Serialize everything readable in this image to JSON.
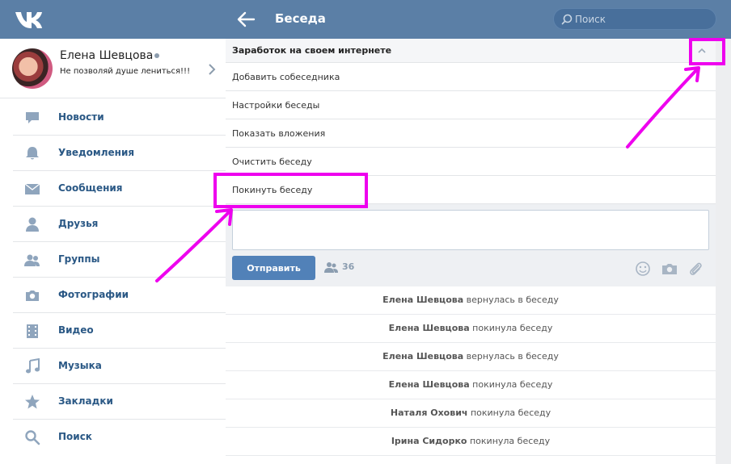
{
  "header": {
    "logo_text": "VK",
    "title": "Беседа",
    "search_placeholder": "Поиск"
  },
  "profile": {
    "name": "Елена Шевцова",
    "status": "Не позволяй душе лениться!!!"
  },
  "sidebar": {
    "items": [
      {
        "label": "Новости",
        "icon": "news-icon"
      },
      {
        "label": "Уведомления",
        "icon": "bell-icon"
      },
      {
        "label": "Сообщения",
        "icon": "envelope-icon"
      },
      {
        "label": "Друзья",
        "icon": "person-icon"
      },
      {
        "label": "Группы",
        "icon": "people-icon"
      },
      {
        "label": "Фотографии",
        "icon": "camera-icon"
      },
      {
        "label": "Видео",
        "icon": "film-icon"
      },
      {
        "label": "Музыка",
        "icon": "music-note-icon"
      },
      {
        "label": "Закладки",
        "icon": "star-icon"
      },
      {
        "label": "Поиск",
        "icon": "search-icon"
      }
    ]
  },
  "chat": {
    "title": "Заработок на своем интернете",
    "options": [
      "Добавить собеседника",
      "Настройки беседы",
      "Показать вложения",
      "Очистить беседу",
      "Покинуть беседу"
    ],
    "send_label": "Отправить",
    "members_count": "36",
    "events": [
      {
        "name": "Елена Шевцова",
        "action": "вернулась в беседу"
      },
      {
        "name": "Елена Шевцова",
        "action": "покинула беседу"
      },
      {
        "name": "Елена Шевцова",
        "action": "вернулась в беседу"
      },
      {
        "name": "Елена Шевцова",
        "action": "покинула беседу"
      },
      {
        "name": "Наталя Охович",
        "action": "покинула беседу"
      },
      {
        "name": "Ірина Сидорко",
        "action": "покинула беседу"
      }
    ]
  },
  "colors": {
    "header_bg": "#5b7fa6",
    "link": "#2a5885",
    "button": "#5181b8",
    "annotation": "#ee00ee"
  }
}
